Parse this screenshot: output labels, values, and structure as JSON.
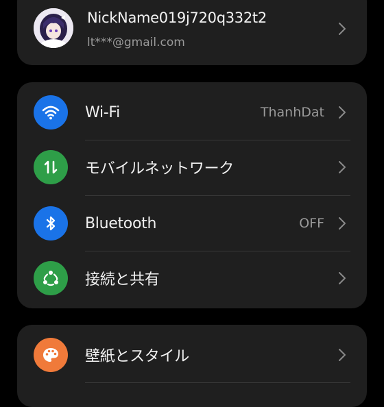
{
  "account": {
    "name": "NickName019j720q332t2",
    "email": "lt***@gmail.com"
  },
  "network_group": {
    "items": [
      {
        "label": "Wi-Fi",
        "value": "ThanhDat",
        "icon": "wifi-icon",
        "color": "#1a73e8"
      },
      {
        "label": "モバイルネットワーク",
        "value": "",
        "icon": "mobile-data-icon",
        "color": "#2e9e48"
      },
      {
        "label": "Bluetooth",
        "value": "OFF",
        "icon": "bluetooth-icon",
        "color": "#1a73e8"
      },
      {
        "label": "接続と共有",
        "value": "",
        "icon": "share-icon",
        "color": "#2e9e48"
      }
    ]
  },
  "style_group": {
    "items": [
      {
        "label": "壁紙とスタイル",
        "icon": "palette-icon",
        "color": "#f07a3a"
      }
    ]
  }
}
